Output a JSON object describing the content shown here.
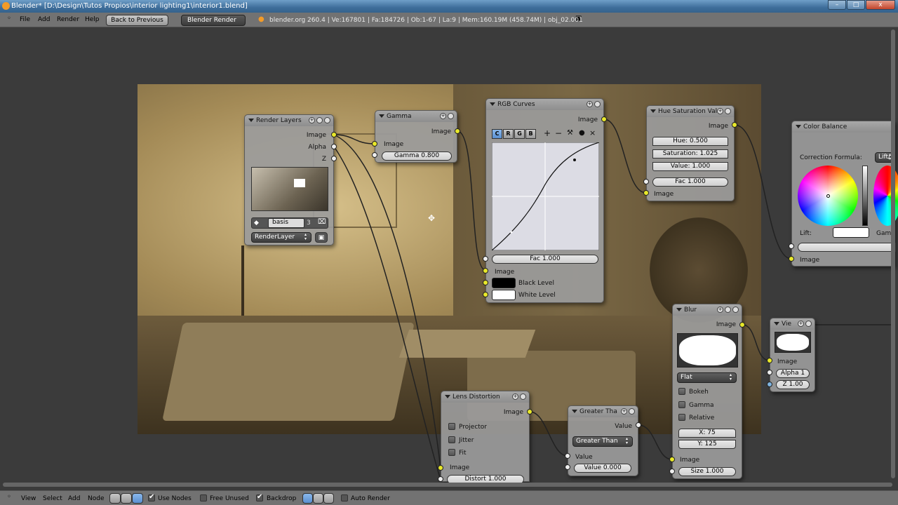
{
  "window": {
    "title": "Blender* [D:\\Design\\Tutos Propios\\interior lighting1\\interior1.blend]",
    "min": "–",
    "max": "□",
    "close": "x"
  },
  "menubar": {
    "file": "File",
    "add": "Add",
    "render": "Render",
    "help": "Help",
    "back": "Back to Previous",
    "engine": "Blender Render",
    "stats": "blender.org 260.4 | Ve:167801 | Fa:184726 | Ob:1-67 | La:9 | Mem:160.19M (458.74M) | obj_02.001"
  },
  "nodes": {
    "render_layers": {
      "title": "Render Layers",
      "out_image": "Image",
      "out_alpha": "Alpha",
      "out_z": "Z",
      "scene": "basis",
      "scene_users": "3",
      "layer": "RenderLayer"
    },
    "gamma": {
      "title": "Gamma",
      "out_image": "Image",
      "in_image": "Image",
      "gamma": "Gamma 0.800"
    },
    "rgb_curves": {
      "title": "RGB Curves",
      "tabs": [
        "C",
        "R",
        "G",
        "B"
      ],
      "out_image": "Image",
      "fac": "Fac 1.000",
      "in_image": "Image",
      "black_level": "Black Level",
      "white_level": "White Level"
    },
    "hue_sat": {
      "title": "Hue Saturation Val",
      "out_image": "Image",
      "hue": "Hue: 0.500",
      "saturation": "Saturation: 1.025",
      "value": "Value: 1.000",
      "fac": "Fac 1.000",
      "in_image": "Image"
    },
    "color_balance": {
      "title": "Color Balance",
      "correction": "Correction Formula:",
      "formula": "Lift/",
      "lift": "Lift:",
      "gamma_short": "Gam",
      "in_image": "Image"
    },
    "blur": {
      "title": "Blur",
      "out_image": "Image",
      "filter": "Flat",
      "bokeh": "Bokeh",
      "gamma": "Gamma",
      "relative": "Relative",
      "x": "X: 75",
      "y": "Y: 125",
      "in_image": "Image",
      "size": "Size 1.000"
    },
    "viewer": {
      "title": "Vie",
      "in_image": "Image",
      "alpha": "Alpha 1",
      "z": "Z 1.00"
    },
    "lens_distortion": {
      "title": "Lens Distortion",
      "out_image": "Image",
      "projector": "Projector",
      "jitter": "Jitter",
      "fit": "Fit",
      "in_image": "Image",
      "distort": "Distort 1.000"
    },
    "greater_than": {
      "title": "Greater Tha",
      "out_value": "Value",
      "op": "Greater Than",
      "in_value": "Value",
      "value": "Value 0.000"
    }
  },
  "bottombar": {
    "view": "View",
    "select": "Select",
    "add": "Add",
    "node": "Node",
    "use_nodes": "Use Nodes",
    "free_unused": "Free Unused",
    "backdrop": "Backdrop",
    "auto_render": "Auto Render"
  },
  "colors": {
    "socket_yellow": "#e8e82a",
    "socket_grey": "#eeeeee",
    "socket_blue": "#7fb4e0",
    "title_bar": "#3e6d9a"
  }
}
